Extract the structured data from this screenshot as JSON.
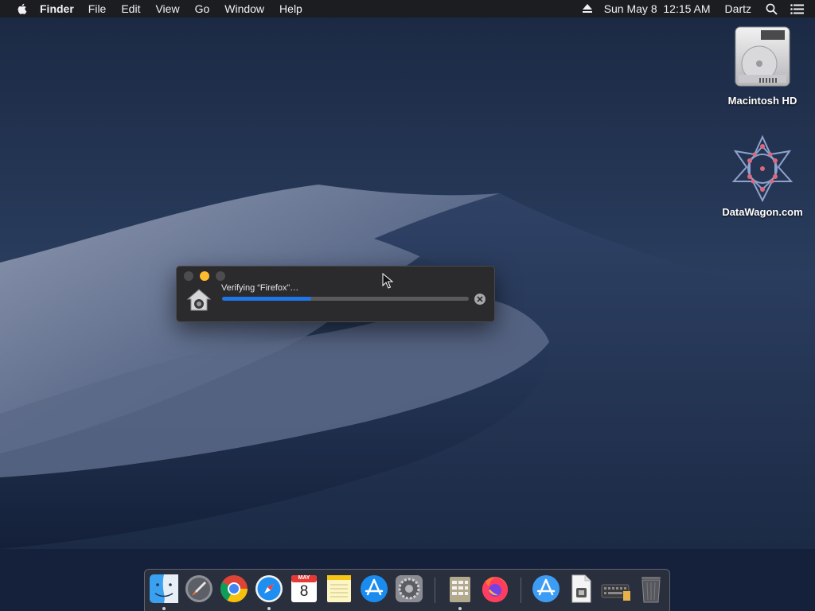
{
  "menubar": {
    "app_name": "Finder",
    "menus": [
      "File",
      "Edit",
      "View",
      "Go",
      "Window",
      "Help"
    ],
    "clock": "Sun May 8  12:15 AM",
    "user": "Dartz",
    "icons": [
      "apple-icon",
      "eject-icon",
      "spotlight-search-icon",
      "notification-center-icon"
    ]
  },
  "desktop": {
    "icons": [
      {
        "label": "Macintosh HD",
        "icon": "hard-drive-icon"
      },
      {
        "label": "DataWagon.com",
        "icon": "datawagon-logo-icon"
      }
    ]
  },
  "progress_window": {
    "label": "Verifying “Firefox”…",
    "progress_fraction": 0.36,
    "icon": "installer-house-icon",
    "cancel_icon": "cancel-x-icon",
    "accent_color": "#1e76e8"
  },
  "calendar_icon": {
    "month": "MAY",
    "day": "8"
  },
  "dock": {
    "items": [
      {
        "name": "finder",
        "running": true
      },
      {
        "name": "launchpad",
        "running": false
      },
      {
        "name": "chrome",
        "running": false
      },
      {
        "name": "safari",
        "running": true
      },
      {
        "name": "calendar",
        "running": false
      },
      {
        "name": "notes",
        "running": false
      },
      {
        "name": "app-store",
        "running": false
      },
      {
        "name": "system-preferences",
        "running": false
      },
      {
        "name": "installer-archive",
        "running": true
      },
      {
        "name": "firefox",
        "running": false
      },
      {
        "name": "applications-folder",
        "running": false
      },
      {
        "name": "document",
        "running": false
      },
      {
        "name": "keyboard-downloads",
        "running": false
      },
      {
        "name": "trash",
        "running": false
      }
    ]
  }
}
